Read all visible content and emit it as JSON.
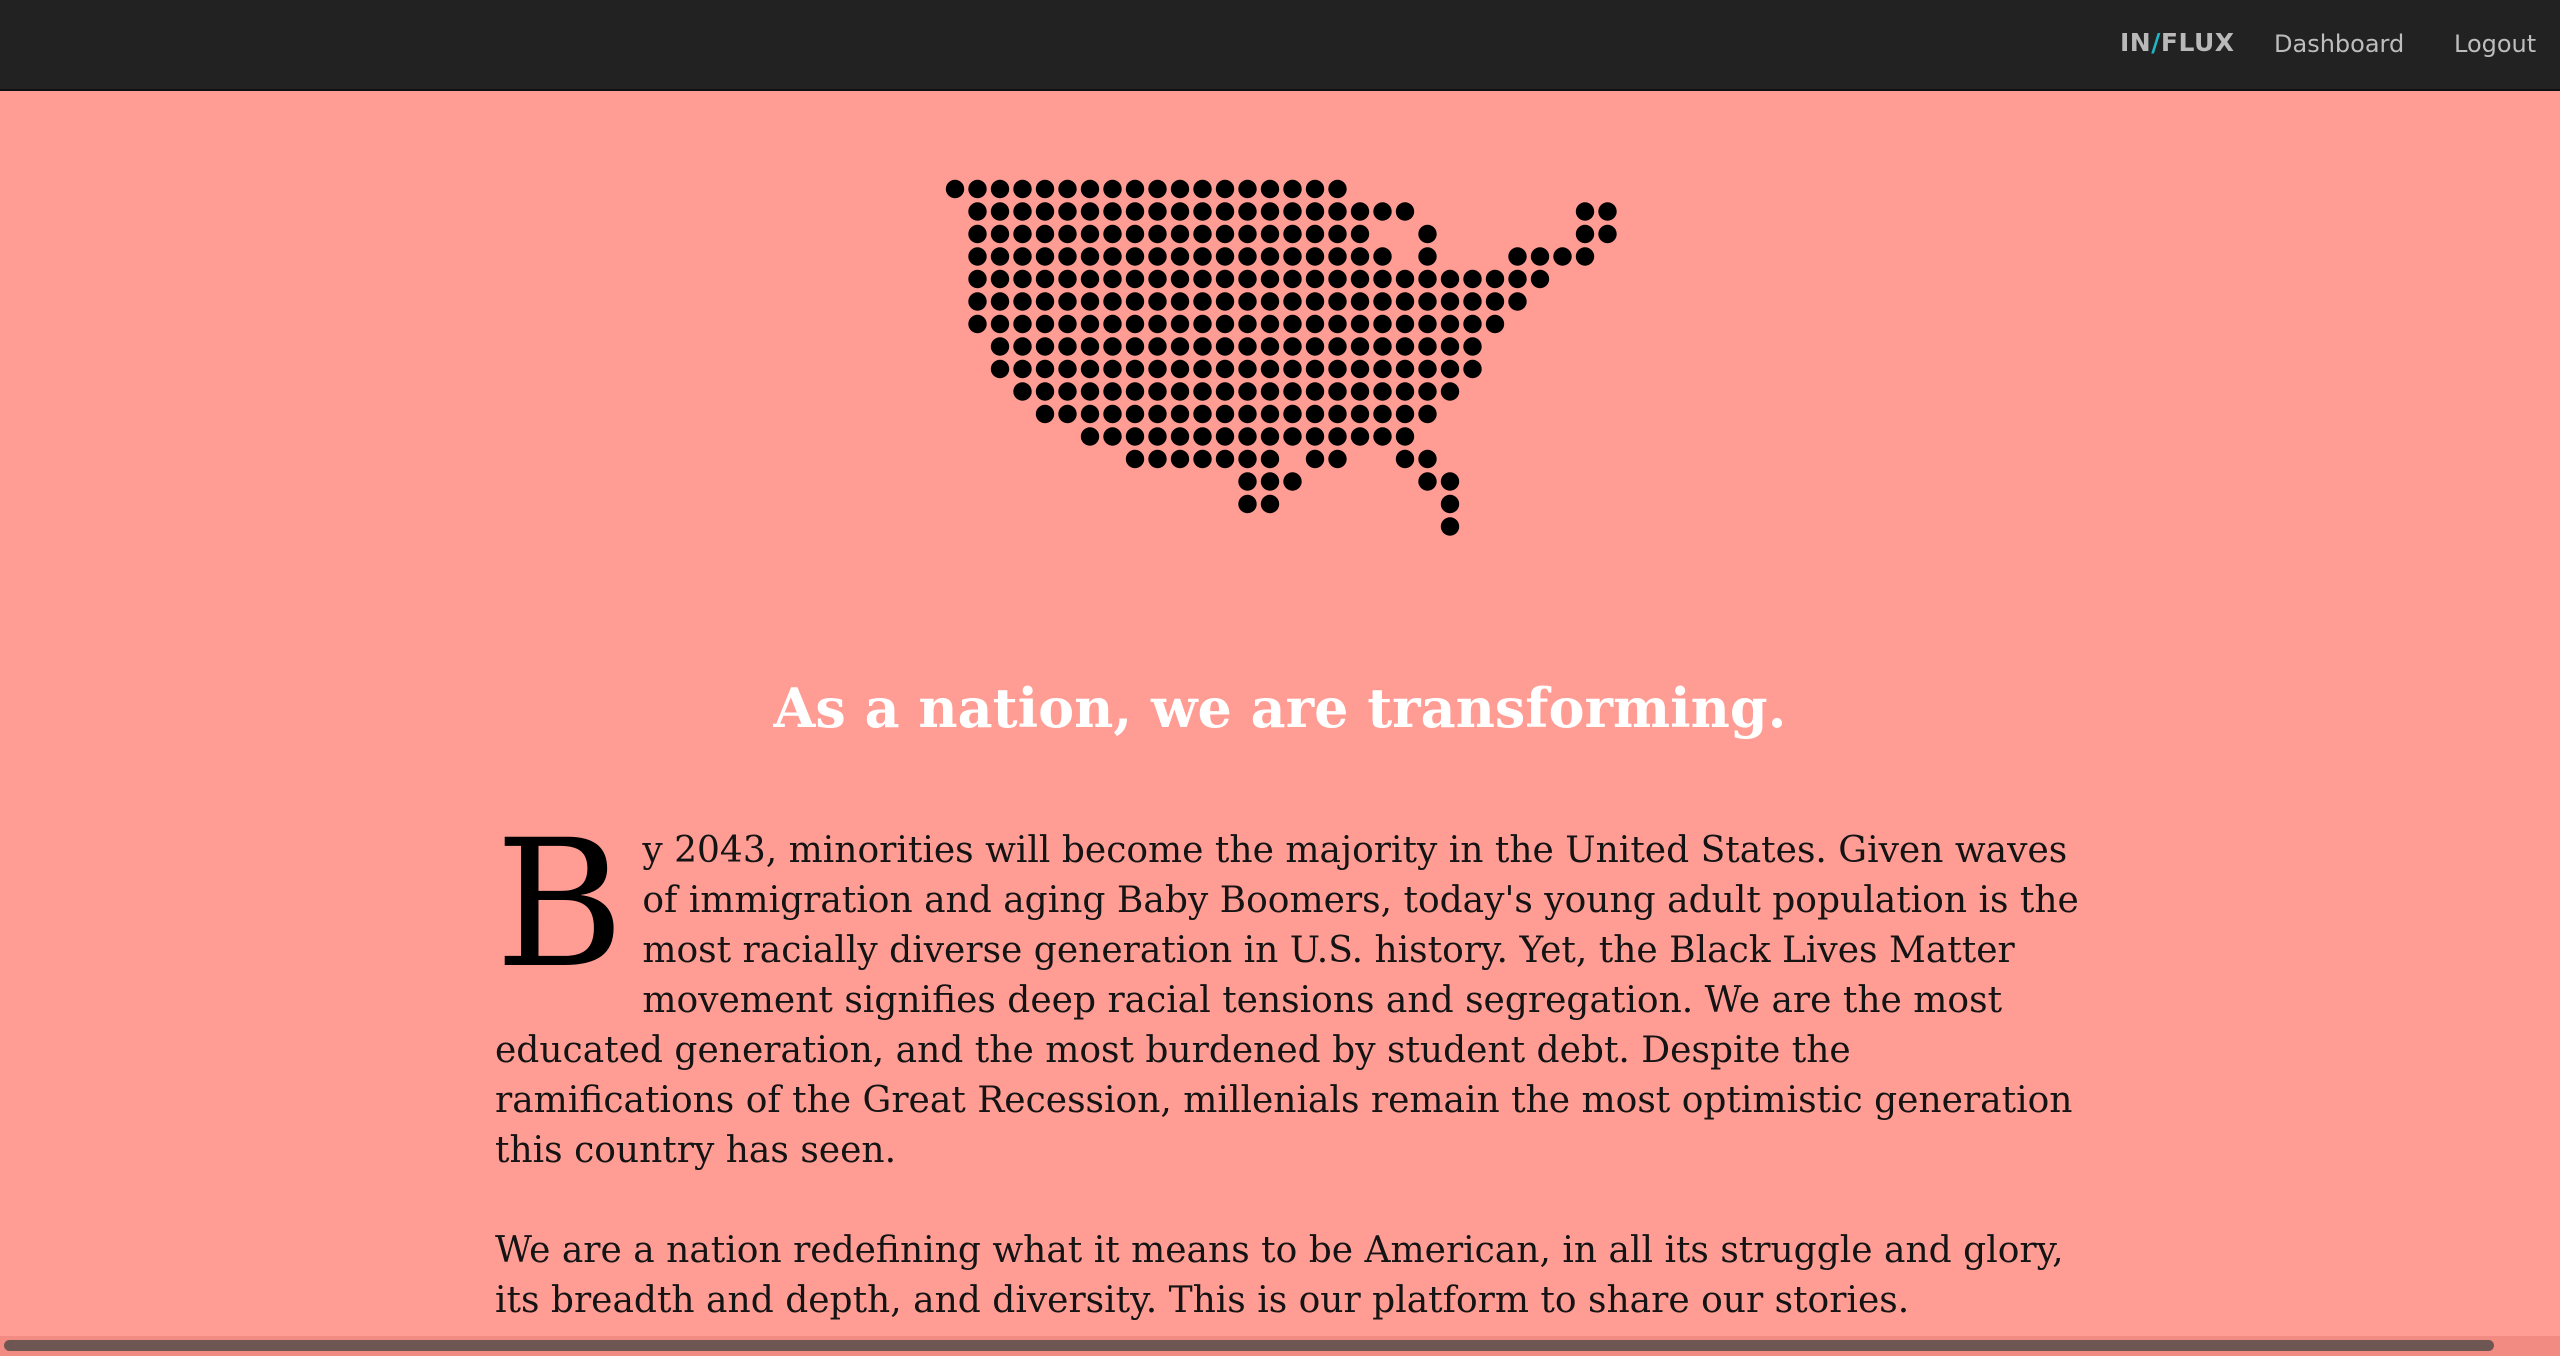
{
  "header": {
    "brand_in": "IN",
    "brand_slash": "/",
    "brand_flux": "FLUX",
    "nav": {
      "dashboard": "Dashboard",
      "logout": "Logout"
    }
  },
  "hero": {
    "map_icon": "dotted-usa-map-icon",
    "headline": "As a nation, we are transforming."
  },
  "article": {
    "dropcap": "B",
    "paragraph1_rest": "y 2043, minorities will become the majority in the United States. Given waves of immigration and aging Baby Boomers, today's young adult population is the most racially diverse generation in U.S. history. Yet, the Black Lives Matter movement signifies deep racial tensions and segregation. We are the most educated generation, and the most burdened by student debt. Despite the ramifications of the Great Recession, millenials remain the most optimistic generation this country has seen.",
    "paragraph2": "We are a nation redefining what it means to be American, in all its struggle and glory, its breadth and depth, and diversity. This is our platform to share our stories."
  },
  "colors": {
    "background": "#ff9d94",
    "topbar": "#222222",
    "brand_accent": "#1fb4c7",
    "dots": "#000000",
    "headline": "#ffffff"
  }
}
